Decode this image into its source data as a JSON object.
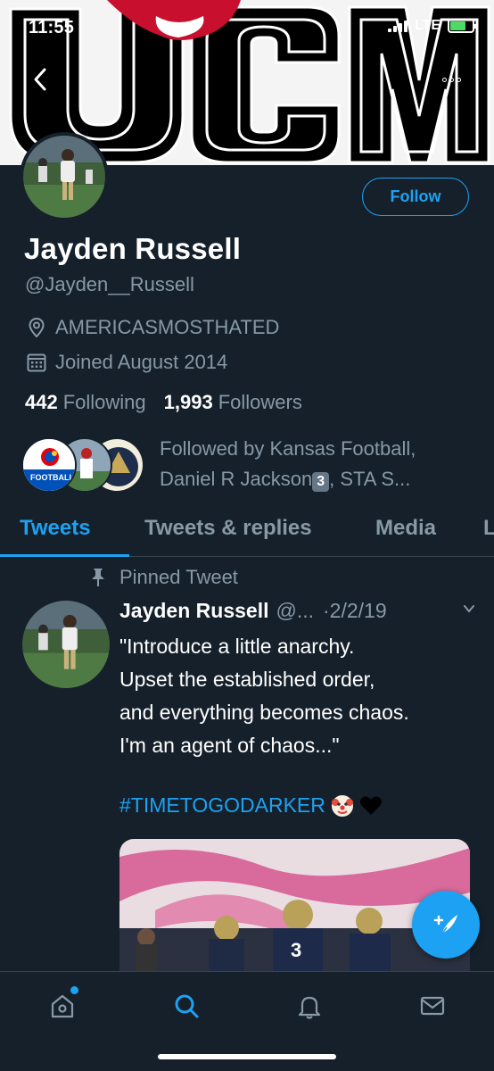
{
  "status_bar": {
    "time": "11:55",
    "network": "LTE"
  },
  "banner": {
    "text": "UCM"
  },
  "profile": {
    "name": "Jayden Russell",
    "handle": "@Jayden__Russell",
    "location": "AMERICASMOSTHATED",
    "joined": "Joined August 2014",
    "following_count": "442",
    "following_label": "Following",
    "followers_count": "1,993",
    "followers_label": "Followers",
    "follow_button": "Follow",
    "followed_by_line1": "Followed by Kansas Football,",
    "followed_by_line2a": "Daniel R Jackson",
    "followed_by_badge": "3",
    "followed_by_line2b": ", STA S...",
    "followed_by_avatar1_text": "FOOTBALL"
  },
  "tabs": [
    {
      "label": "Tweets"
    },
    {
      "label": "Tweets & replies"
    },
    {
      "label": "Media"
    },
    {
      "label": "L"
    }
  ],
  "tweet": {
    "pinned_label": "Pinned Tweet",
    "author": "Jayden Russell",
    "handle": "@...",
    "date": "·2/2/19",
    "line1": "\"Introduce a little anarchy.",
    "line2": "Upset the established order,",
    "line3": "and everything becomes chaos.",
    "line4": "I'm an agent of chaos...\"",
    "hashtag": "#TIMETOGODARKER"
  },
  "icons": {
    "back": "back-arrow-icon",
    "more": "more-icon",
    "location": "location-pin-icon",
    "calendar": "calendar-icon",
    "pin": "pin-icon",
    "compose": "compose-tweet-icon",
    "home": "home-icon",
    "search": "search-icon",
    "notifications": "bell-icon",
    "messages": "mail-icon"
  },
  "colors": {
    "accent": "#1da1f2",
    "background": "#15202b",
    "muted": "#8899a6"
  }
}
